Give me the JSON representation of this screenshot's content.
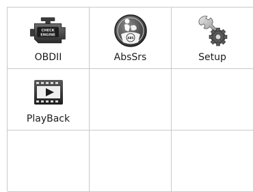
{
  "menu": {
    "items": [
      {
        "label": "OBDII",
        "icon": "check-engine-icon",
        "engine_text_1": "CHECK",
        "engine_text_2": "ENGINE"
      },
      {
        "label": "AbsSrs",
        "icon": "airbag-abs-icon",
        "badge_text": "ABS"
      },
      {
        "label": "Setup",
        "icon": "wrench-gear-icon"
      },
      {
        "label": "PlayBack",
        "icon": "film-play-icon"
      }
    ]
  }
}
